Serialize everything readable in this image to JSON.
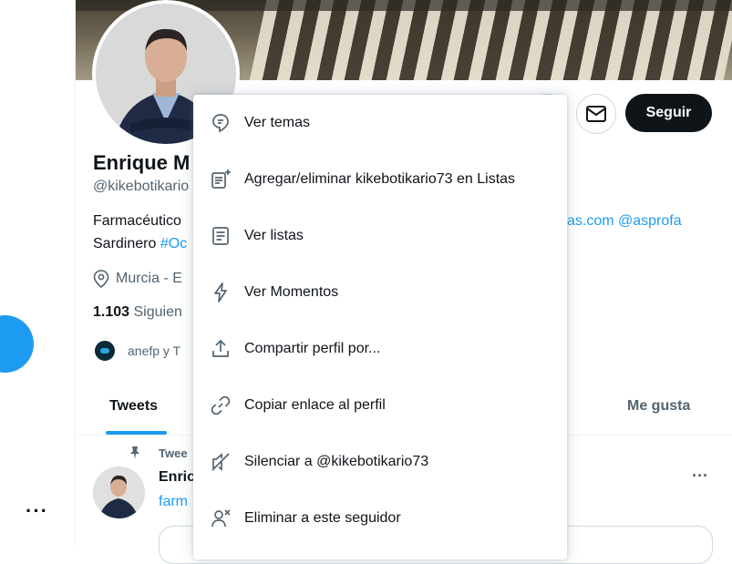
{
  "colors": {
    "accent": "#1d9bf0",
    "text": "#0f1419",
    "muted": "#536471",
    "follow_bg": "#0f1419"
  },
  "left_rail": {
    "more_label": "···"
  },
  "profile": {
    "name": "Enrique M",
    "handle": "@kikebotikario",
    "bio_line1": "Farmacéutico",
    "bio_line1_right": "as.com @asprofa",
    "bio_line2_prefix": "Sardinero ",
    "bio_line2_hashtag": "#Oc",
    "location": "Murcia - E",
    "following_count": "1.103",
    "following_label": "Siguien",
    "followed_by": "anefp y T",
    "follow_button": "Seguir"
  },
  "tabs": [
    {
      "label": "Tweets",
      "active": true
    },
    {
      "label": "Me gusta",
      "active": false
    }
  ],
  "pinned_tweet": {
    "pinned_label": "Twee",
    "author": "Enric",
    "text": "farm",
    "more_label": "···"
  },
  "menu": {
    "items": [
      {
        "label": "Ver temas",
        "icon": "topics-icon"
      },
      {
        "label": "Agregar/eliminar kikebotikario73 en Listas",
        "icon": "list-add-icon"
      },
      {
        "label": "Ver listas",
        "icon": "list-icon"
      },
      {
        "label": "Ver Momentos",
        "icon": "lightning-icon"
      },
      {
        "label": "Compartir perfil por...",
        "icon": "share-icon"
      },
      {
        "label": "Copiar enlace al perfil",
        "icon": "link-icon"
      },
      {
        "label": "Silenciar a @kikebotikario73",
        "icon": "mute-icon"
      },
      {
        "label": "Eliminar a este seguidor",
        "icon": "remove-follower-icon"
      }
    ]
  }
}
